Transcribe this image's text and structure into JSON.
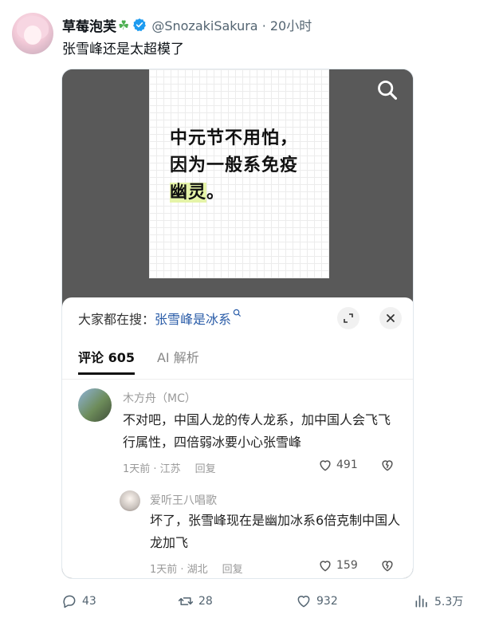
{
  "tweet": {
    "author_name": "草莓泡芙",
    "author_emoji": "☘",
    "handle_time": "@SnozakiSakura · 20小时",
    "text": "张雪峰还是太超模了"
  },
  "poster": {
    "line1": "中元节不用怕，",
    "line2": "因为一般系免疫",
    "line3_hl": "幽灵",
    "line3_tail": "。"
  },
  "sheet": {
    "search_prefix": "大家都在搜：",
    "search_keyword": "张雪峰是冰系",
    "tab_comments": "评论 605",
    "tab_ai": "AI 解析"
  },
  "comments": [
    {
      "name": "木方舟（MC）",
      "text": "不对吧，中国人龙的传人龙系，加中国人会飞飞行属性，四倍弱冰要小心张雪峰",
      "time_loc": "1天前 · 江苏",
      "reply": "回复",
      "likes": "491"
    },
    {
      "name": "爱听王八唱歌",
      "text": "坏了，张雪峰现在是幽加冰系6倍克制中国人龙加飞",
      "time_loc": "1天前 · 湖北",
      "reply": "回复",
      "likes": "159"
    }
  ],
  "actions": {
    "replies": "43",
    "retweets": "28",
    "likes": "932",
    "views": "5.3万"
  },
  "colors": {
    "verified": "#1d9bf0",
    "highlight": "#e5f4a8",
    "keyword": "#2a5ca8"
  }
}
